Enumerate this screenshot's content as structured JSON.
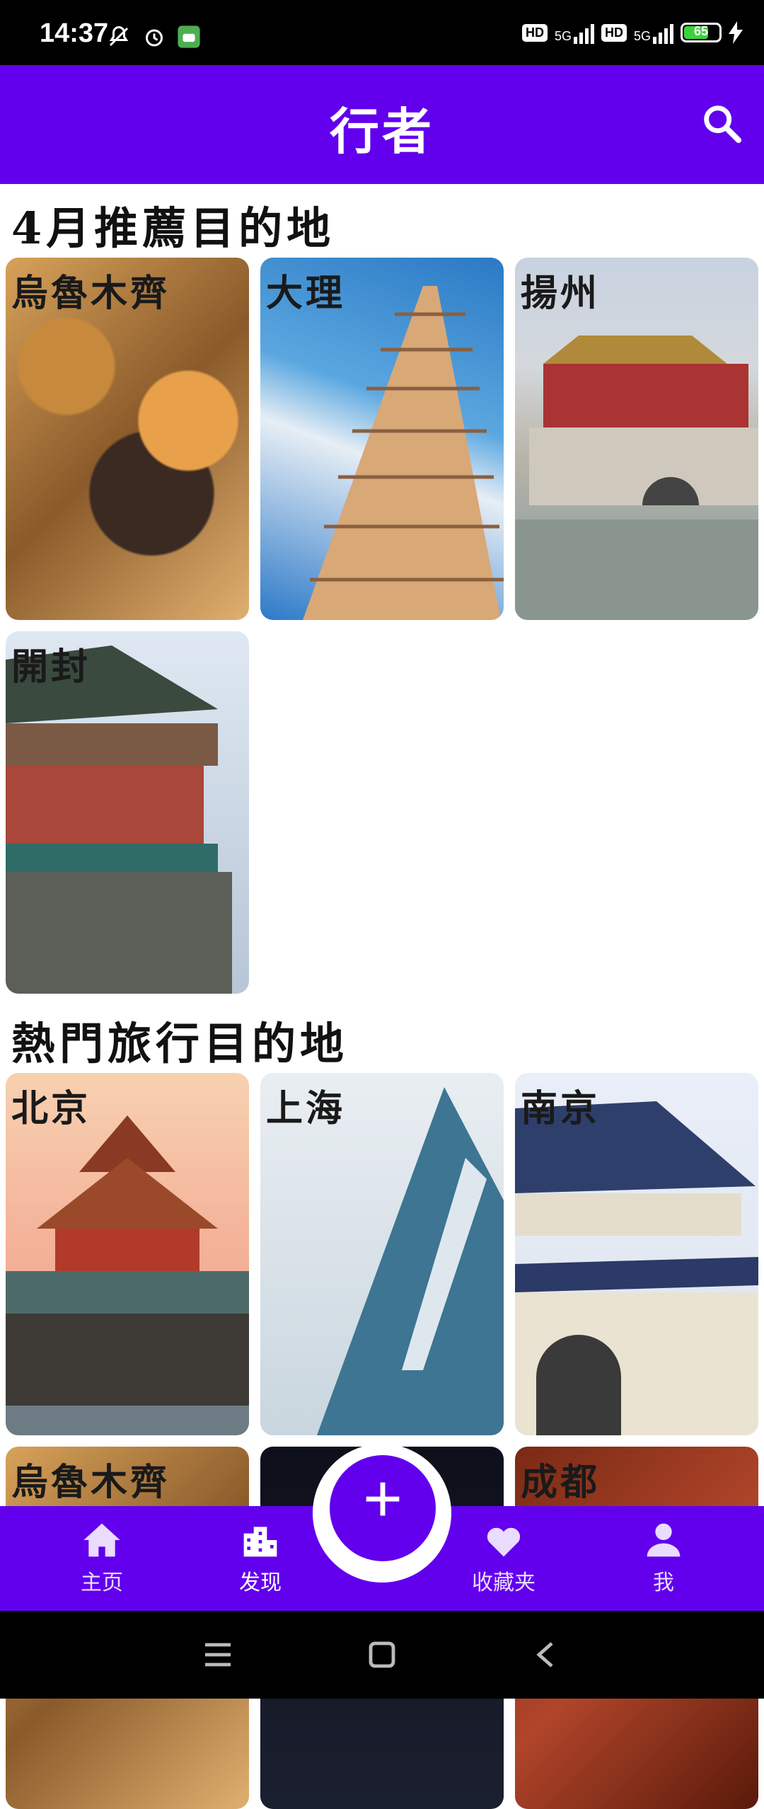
{
  "status_bar": {
    "time": "14:37",
    "hd1": "HD",
    "net1": "5G",
    "hd2": "HD",
    "net2": "5G",
    "battery": "65"
  },
  "app_bar": {
    "title": "行者",
    "search_icon": "search-icon"
  },
  "sections": [
    {
      "title": "4月推薦目的地",
      "cards": [
        {
          "label": "烏魯木齊"
        },
        {
          "label": "大理"
        },
        {
          "label": "揚州"
        },
        {
          "label": "開封"
        }
      ]
    },
    {
      "title": "熱門旅行目的地",
      "cards": [
        {
          "label": "北京"
        },
        {
          "label": "上海"
        },
        {
          "label": "南京"
        },
        {
          "label": "烏魯木齊"
        },
        {
          "label": ""
        },
        {
          "label": "成都"
        }
      ]
    }
  ],
  "bottom_nav": {
    "items": [
      {
        "label": "主页",
        "icon": "home-icon"
      },
      {
        "label": "发现",
        "icon": "city-icon"
      },
      {
        "label": "收藏夹",
        "icon": "heart-icon"
      },
      {
        "label": "我",
        "icon": "person-icon"
      }
    ],
    "fab_icon": "+",
    "active": "发现"
  },
  "colors": {
    "primary": "#6200ee",
    "nav_inactive": "#e9dcff"
  }
}
